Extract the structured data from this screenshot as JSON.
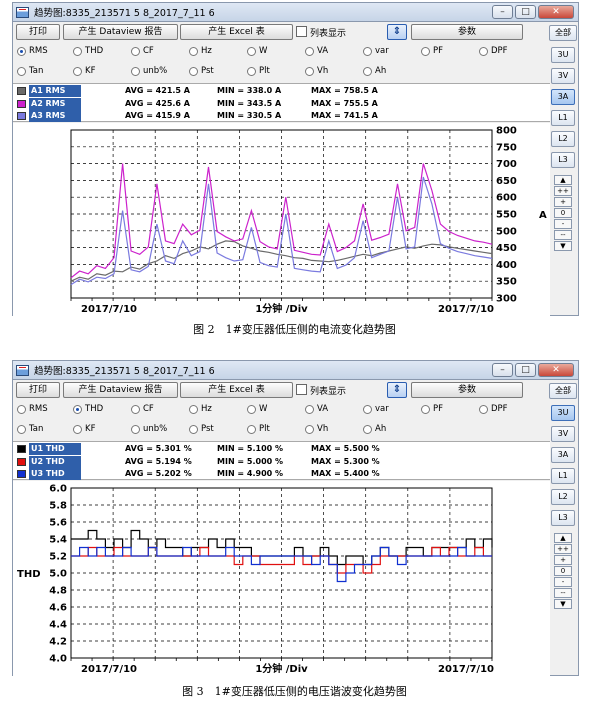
{
  "panels": [
    {
      "window_title": "趋势图:8335_213571 5 8_2017_7_11 6",
      "toolbar": {
        "print": "打印",
        "dataview_report": "产生 Dataview 报告",
        "excel": "产生 Excel 表",
        "list_display": "列表显示",
        "params": "参数"
      },
      "radio_row1": [
        "RMS",
        "THD",
        "CF",
        "Hz",
        "W",
        "VA",
        "var",
        "PF",
        "DPF"
      ],
      "radio_row2": [
        "Tan",
        "KF",
        "unb%",
        "Pst",
        "Plt",
        "Vh",
        "Ah"
      ],
      "selected_radio": "RMS",
      "legend": [
        {
          "name": "A1 RMS",
          "avg": "AVG = 421.5 A",
          "min": "MIN = 338.0 A",
          "max": "MAX = 758.5 A",
          "color": "#6a6a6a"
        },
        {
          "name": "A2 RMS",
          "avg": "AVG = 425.6 A",
          "min": "MIN = 343.5 A",
          "max": "MAX = 755.5 A",
          "color": "#cc22cc"
        },
        {
          "name": "A3 RMS",
          "avg": "AVG = 415.9 A",
          "min": "MIN = 330.5 A",
          "max": "MAX = 741.5 A",
          "color": "#7a7adf"
        }
      ],
      "sidebar": {
        "all": "全部",
        "buttons": [
          "3U",
          "3V",
          "3A",
          "L1",
          "L2",
          "L3"
        ],
        "active": "3A",
        "zoom_top": "▲",
        "zoom_in": "++",
        "plus": "+",
        "zero": "0",
        "minus": "-",
        "zoom_out": "--",
        "zoom_bottom": "▼"
      },
      "x_labels": {
        "left": "2017/7/10",
        "center": "1分钟 /Div",
        "right": "2017/7/10"
      },
      "y_unit": "A",
      "caption": "图 2　1#变压器低压侧的电流变化趋势图",
      "chart_data": {
        "type": "line",
        "ylim": [
          300,
          800
        ],
        "yticks": [
          300,
          350,
          400,
          450,
          500,
          550,
          600,
          650,
          700,
          750,
          800
        ],
        "ylabel": "A",
        "xlabel": "1分钟 /Div",
        "series": [
          {
            "name": "A1 RMS",
            "color": "#6a6a6a",
            "values": [
              350,
              362,
              356,
              372,
              368,
              380,
              378,
              392,
              386,
              402,
              410,
              426,
              418,
              432,
              440,
              452,
              446,
              460,
              470,
              468,
              455,
              448,
              440,
              436,
              430,
              426,
              420,
              418,
              412,
              410,
              408,
              412,
              418,
              424,
              430,
              426,
              434,
              440,
              446,
              452,
              448,
              455,
              460,
              458,
              452,
              448,
              444,
              440,
              436,
              432
            ]
          },
          {
            "name": "A2 RMS",
            "color": "#cc22cc",
            "values": [
              360,
              380,
              372,
              396,
              388,
              420,
              700,
              440,
              430,
              452,
              640,
              470,
              462,
              520,
              488,
              502,
              690,
              498,
              482,
              470,
              476,
              560,
              468,
              452,
              446,
              600,
              442,
              436,
              430,
              428,
              520,
              438,
              450,
              470,
              580,
              472,
              480,
              490,
              640,
              500,
              510,
              700,
              620,
              520,
              498,
              486,
              478,
              470,
              466,
              460
            ]
          },
          {
            "name": "A3 RMS",
            "color": "#7a7adf",
            "values": [
              340,
              356,
              348,
              362,
              358,
              372,
              560,
              384,
              378,
              394,
              520,
              410,
              402,
              470,
              426,
              438,
              640,
              434,
              420,
              410,
              414,
              510,
              406,
              396,
              392,
              550,
              388,
              384,
              380,
              378,
              470,
              388,
              398,
              420,
              530,
              420,
              430,
              440,
              600,
              446,
              452,
              660,
              580,
              462,
              448,
              438,
              432,
              426,
              422,
              418
            ]
          }
        ]
      }
    },
    {
      "window_title": "趋势图:8335_213571 5 8_2017_7_11 6",
      "toolbar": {
        "print": "打印",
        "dataview_report": "产生 Dataview 报告",
        "excel": "产生 Excel 表",
        "list_display": "列表显示",
        "params": "参数"
      },
      "radio_row1": [
        "RMS",
        "THD",
        "CF",
        "Hz",
        "W",
        "VA",
        "var",
        "PF",
        "DPF"
      ],
      "radio_row2": [
        "Tan",
        "KF",
        "unb%",
        "Pst",
        "Plt",
        "Vh",
        "Ah"
      ],
      "selected_radio": "THD",
      "legend": [
        {
          "name": "U1 THD",
          "avg": "AVG = 5.301 %",
          "min": "MIN = 5.100 %",
          "max": "MAX = 5.500 %",
          "color": "#000000"
        },
        {
          "name": "U2 THD",
          "avg": "AVG = 5.194 %",
          "min": "MIN = 5.000 %",
          "max": "MAX = 5.300 %",
          "color": "#e01010"
        },
        {
          "name": "U3 THD",
          "avg": "AVG = 5.202 %",
          "min": "MIN = 4.900 %",
          "max": "MAX = 5.400 %",
          "color": "#1030d0"
        }
      ],
      "sidebar": {
        "all": "全部",
        "buttons": [
          "3U",
          "3V",
          "3A",
          "L1",
          "L2",
          "L3"
        ],
        "active": "3U",
        "zoom_top": "▲",
        "zoom_in": "++",
        "plus": "+",
        "zero": "0",
        "minus": "-",
        "zoom_out": "--",
        "zoom_bottom": "▼"
      },
      "x_labels": {
        "left": "2017/7/10",
        "center": "1分钟 /Div",
        "right": "2017/7/10"
      },
      "y_unit": "THD",
      "caption": "图 3　1#变压器低压侧的电压谐波变化趋势图",
      "chart_data": {
        "type": "line",
        "ylim": [
          4.0,
          6.0
        ],
        "yticks": [
          4.0,
          4.2,
          4.4,
          4.6,
          4.8,
          5.0,
          5.2,
          5.4,
          5.6,
          5.8,
          6.0
        ],
        "ylabel": "THD",
        "xlabel": "1分钟 /Div",
        "series": [
          {
            "name": "U1 THD",
            "color": "#000000",
            "values": [
              5.4,
              5.4,
              5.5,
              5.4,
              5.3,
              5.4,
              5.3,
              5.5,
              5.4,
              5.3,
              5.4,
              5.3,
              5.3,
              5.2,
              5.3,
              5.3,
              5.4,
              5.3,
              5.4,
              5.3,
              5.3,
              5.2,
              5.2,
              5.2,
              5.2,
              5.2,
              5.3,
              5.2,
              5.2,
              5.3,
              5.2,
              5.1,
              5.2,
              5.2,
              5.1,
              5.2,
              5.3,
              5.2,
              5.2,
              5.3,
              5.3,
              5.2,
              5.3,
              5.3,
              5.3,
              5.3,
              5.4,
              5.3,
              5.4,
              5.3
            ]
          },
          {
            "name": "U2 THD",
            "color": "#e01010",
            "values": [
              5.2,
              5.2,
              5.3,
              5.2,
              5.2,
              5.3,
              5.2,
              5.2,
              5.2,
              5.3,
              5.2,
              5.2,
              5.2,
              5.2,
              5.2,
              5.3,
              5.2,
              5.2,
              5.2,
              5.1,
              5.2,
              5.2,
              5.1,
              5.1,
              5.1,
              5.1,
              5.2,
              5.1,
              5.2,
              5.2,
              5.1,
              5.0,
              5.1,
              5.1,
              5.0,
              5.1,
              5.2,
              5.2,
              5.2,
              5.2,
              5.2,
              5.2,
              5.3,
              5.2,
              5.3,
              5.2,
              5.2,
              5.3,
              5.2,
              5.2
            ]
          },
          {
            "name": "U3 THD",
            "color": "#1030d0",
            "values": [
              5.2,
              5.3,
              5.2,
              5.3,
              5.2,
              5.2,
              5.3,
              5.2,
              5.2,
              5.3,
              5.2,
              5.2,
              5.2,
              5.3,
              5.2,
              5.2,
              5.2,
              5.2,
              5.3,
              5.2,
              5.2,
              5.1,
              5.2,
              5.2,
              5.2,
              5.2,
              5.2,
              5.2,
              5.1,
              5.2,
              5.1,
              4.9,
              5.0,
              5.1,
              5.1,
              5.2,
              5.3,
              5.2,
              5.1,
              5.2,
              5.2,
              5.2,
              5.2,
              5.2,
              5.2,
              5.3,
              5.2,
              5.2,
              5.2,
              5.2
            ]
          }
        ]
      }
    }
  ]
}
